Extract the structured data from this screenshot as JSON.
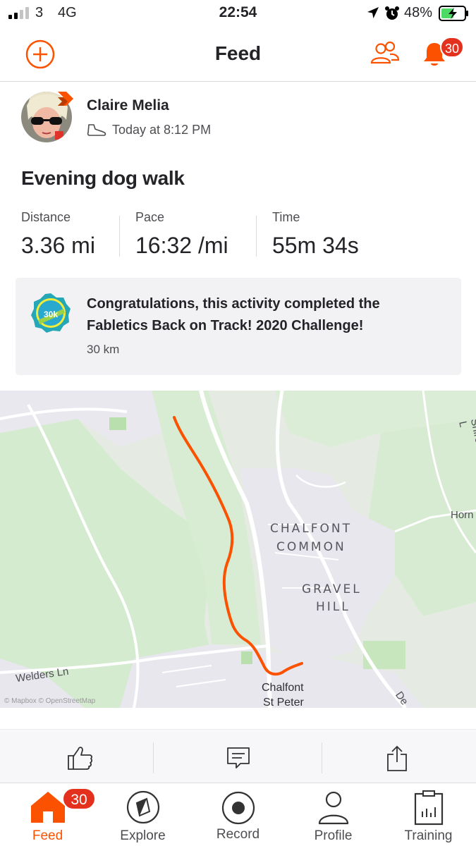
{
  "status_bar": {
    "carrier": "3",
    "network": "4G",
    "time": "22:54",
    "battery": "48%"
  },
  "header": {
    "title": "Feed",
    "notification_count": "30"
  },
  "activity": {
    "athlete_name": "Claire Melia",
    "timestamp": "Today at 8:12 PM",
    "activity_icon": "shoe-icon",
    "title": "Evening dog walk",
    "stats": [
      {
        "label": "Distance",
        "value": "3.36 mi"
      },
      {
        "label": "Pace",
        "value": "16:32 /mi"
      },
      {
        "label": "Time",
        "value": "55m 34s"
      }
    ],
    "challenge": {
      "text": "Congratulations, this activity completed the Fabletics Back on Track! 2020 Challenge!",
      "distance": "30 km",
      "badge_text": "30k"
    }
  },
  "map": {
    "labels": {
      "chalfont_common_1": "CHALFONT",
      "chalfont_common_2": "COMMON",
      "gravel_hill_1": "GRAVEL",
      "gravel_hill_2": "HILL",
      "chalfont_st_peter_1": "Chalfont",
      "chalfont_st_peter_2": "St Peter",
      "welders_ln": "Welders Ln",
      "horn": "Horn",
      "shire": "Shire L",
      "de": "De"
    },
    "attribution": "© Mapbox © OpenStreetMap",
    "route_color": "#fc5200"
  },
  "actions": [
    "like-icon",
    "comment-icon",
    "share-icon"
  ],
  "tabs": [
    {
      "label": "Feed",
      "badge": "30"
    },
    {
      "label": "Explore"
    },
    {
      "label": "Record"
    },
    {
      "label": "Profile"
    },
    {
      "label": "Training"
    }
  ],
  "colors": {
    "accent": "#fc5200",
    "badge": "#e3311d"
  }
}
